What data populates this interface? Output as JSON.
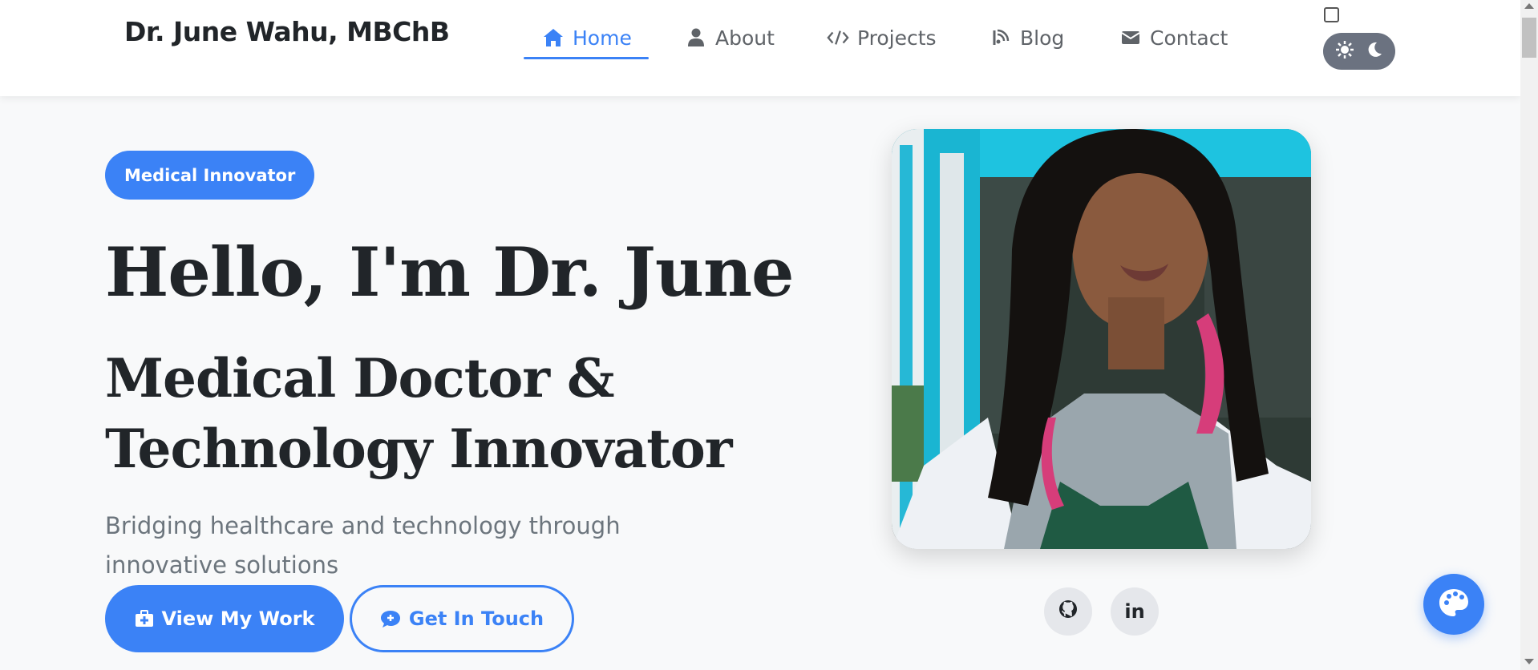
{
  "navbar": {
    "brand": "Dr. June Wahu, MBChB",
    "items": [
      {
        "label": "Home",
        "icon": "home-icon",
        "active": true
      },
      {
        "label": "About",
        "icon": "user-icon",
        "active": false
      },
      {
        "label": "Projects",
        "icon": "code-icon",
        "active": false
      },
      {
        "label": "Blog",
        "icon": "blog-icon",
        "active": false
      },
      {
        "label": "Contact",
        "icon": "envelope-icon",
        "active": false
      }
    ],
    "theme_toggle": {
      "light_icon": "sun-icon",
      "dark_icon": "moon-icon"
    }
  },
  "hero": {
    "badge": "Medical Innovator",
    "title": "Hello, I'm Dr. June",
    "subtitle_line1": "Medical Doctor &",
    "subtitle_line2": "Technology Innovator",
    "description": "Bridging healthcare and technology through innovative solutions",
    "primary_button": {
      "label": "View My Work",
      "icon": "medkit-icon"
    },
    "secondary_button": {
      "label": "Get In Touch",
      "icon": "chat-icon"
    }
  },
  "social": [
    {
      "icon": "github-icon"
    },
    {
      "label": "in",
      "icon": "linkedin-icon"
    }
  ],
  "floating": {
    "icon": "palette-icon"
  },
  "colors": {
    "accent": "#3b82f6",
    "text": "#212529",
    "muted": "#6c757d",
    "background": "#f8f9fa"
  }
}
